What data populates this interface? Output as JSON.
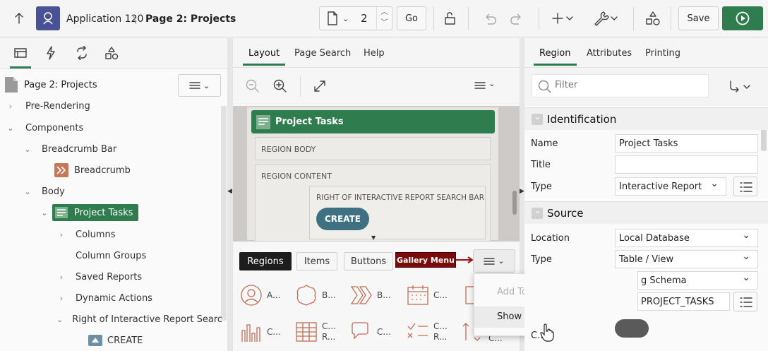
{
  "header": {
    "app_name": "Application 120",
    "page_name": "Page 2: Projects",
    "page_number": "2",
    "go_label": "Go",
    "save_label": "Save"
  },
  "left": {
    "page_label": "Page 2: Projects",
    "tree": [
      {
        "label": "Pre-Rendering"
      },
      {
        "label": "Components"
      },
      {
        "label": "Breadcrumb Bar"
      },
      {
        "label": "Breadcrumb"
      },
      {
        "label": "Body"
      },
      {
        "label": "Project Tasks"
      },
      {
        "label": "Columns"
      },
      {
        "label": "Column Groups"
      },
      {
        "label": "Saved Reports"
      },
      {
        "label": "Dynamic Actions"
      },
      {
        "label": "Right of Interactive Report Search B"
      },
      {
        "label": "CREATE"
      }
    ]
  },
  "mid": {
    "tabs": [
      "Layout",
      "Page Search",
      "Help"
    ],
    "region_title": "Project Tasks",
    "region_body": "REGION BODY",
    "region_content": "REGION CONTENT",
    "right_of_search": "RIGHT OF INTERACTIVE REPORT SEARCH BAR",
    "create_label": "CREATE",
    "gallery_tabs": [
      "Regions",
      "Items",
      "Buttons"
    ],
    "gallery_menu_callout": "Gallery Menu",
    "gallery_items": [
      "A...",
      "B...",
      "B...",
      "C...",
      "C...",
      "C...",
      "R...",
      "C...",
      "C...",
      "R...",
      "C..."
    ],
    "dropdown": {
      "add_to": "Add To",
      "show_legacy": "Show Legacy Components"
    }
  },
  "right": {
    "tabs": [
      "Region",
      "Attributes",
      "Printing"
    ],
    "filter_placeholder": "Filter",
    "identification": {
      "title": "Identification",
      "name_label": "Name",
      "name_value": "Project Tasks",
      "title_label": "Title",
      "title_value": "",
      "type_label": "Type",
      "type_value": "Interactive Report"
    },
    "source": {
      "title": "Source",
      "location_label": "Location",
      "location_value": "Local Database",
      "type_label": "Type",
      "type_value": "Table / View",
      "schema_partial": "g Schema",
      "table_partial": "PROJECT_TASKS",
      "column_partial": "C...n"
    }
  },
  "colors": {
    "accent": "#2f7d4f",
    "create_button": "#3f7182",
    "callout": "#7b0b0b"
  }
}
